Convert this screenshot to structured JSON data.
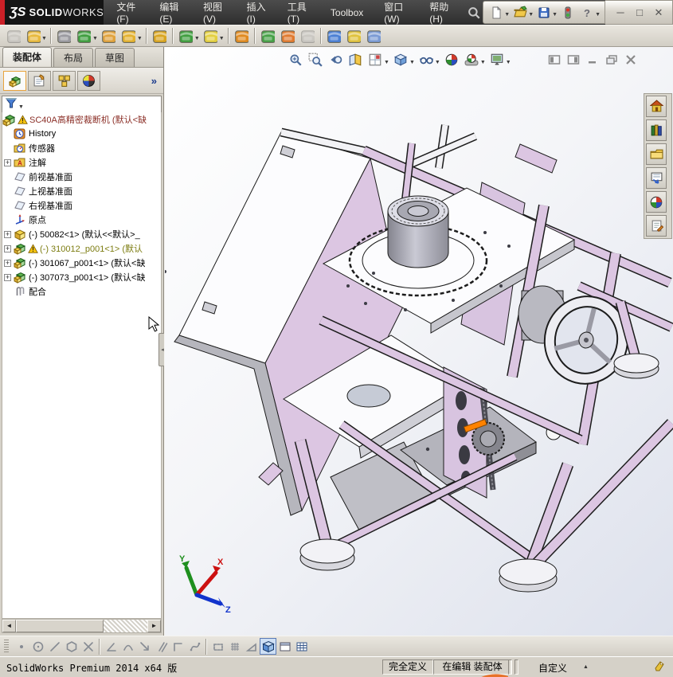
{
  "app": {
    "logo_glyph": "ƷS",
    "logo_brand_bold": "SOLID",
    "logo_brand_light": "WORKS",
    "brand_red": "#cc2027"
  },
  "menubar": {
    "items": [
      "文件(F)",
      "编辑(E)",
      "视图(V)",
      "插入(I)",
      "工具(T)",
      "Toolbox",
      "窗口(W)",
      "帮助(H)"
    ],
    "search_icon": "search-icon"
  },
  "quick_access": {
    "icons": [
      {
        "name": "new-document",
        "dropdown": true
      },
      {
        "name": "open-document",
        "dropdown": true
      },
      {
        "name": "save",
        "dropdown": true
      },
      {
        "name": "options-traffic-light",
        "dropdown": false
      },
      {
        "name": "help",
        "dropdown": true
      }
    ]
  },
  "window_controls": [
    {
      "name": "minimize",
      "glyph": "─"
    },
    {
      "name": "maximize",
      "glyph": "□"
    },
    {
      "name": "close",
      "glyph": "✕"
    }
  ],
  "assembly_toolbar": [
    {
      "name": "insert-components",
      "c": "#b8b5ad",
      "disabled": true
    },
    {
      "name": "open-component",
      "c": "#e8b93c",
      "dropdown": true,
      "sep_after": true
    },
    {
      "name": "attachments",
      "c": "#9a9aa0"
    },
    {
      "name": "mate",
      "c": "#3f9e3f",
      "dropdown": true
    },
    {
      "name": "component-preview-window",
      "c": "#e0a23c"
    },
    {
      "name": "rotate-component",
      "c": "#e3b12f",
      "dropdown": true,
      "sep_after": true
    },
    {
      "name": "smart-fasteners",
      "c": "#d9a520",
      "sep_after": true
    },
    {
      "name": "assembly-features",
      "c": "#3f9e3f",
      "dropdown": true
    },
    {
      "name": "new-part",
      "c": "#e3cf3f",
      "dropdown": true,
      "sep_after": true
    },
    {
      "name": "motion-study-gears",
      "c": "#e08a1f",
      "sep_after": true
    },
    {
      "name": "show-component-window",
      "c": "#46a046"
    },
    {
      "name": "move-component",
      "c": "#e07a2f"
    },
    {
      "name": "suppressed-tool",
      "c": "#b8b5ad",
      "disabled": true,
      "sep_after": true
    },
    {
      "name": "measure",
      "c": "#4a7fd4"
    },
    {
      "name": "interference-detection",
      "c": "#e0c23c"
    },
    {
      "name": "appearance-image",
      "c": "#7a9ad4"
    }
  ],
  "command_tabs": {
    "active": 0,
    "items": [
      "装配体",
      "布局",
      "草图"
    ]
  },
  "feature_manager": {
    "header_icons": [
      "featuremanager-tree",
      "propertymanager",
      "configurationmanager",
      "displaymanager"
    ],
    "expand_chevron": "»",
    "filter_icon": "filter-funnel-icon",
    "tree": [
      {
        "icon": "assembly-top",
        "warning": true,
        "label": "SC40A高精密裁断机  (默认<缺",
        "color": "#8b2f27",
        "level": 0
      },
      {
        "icon": "history-folder",
        "label": "History",
        "level": 1
      },
      {
        "icon": "sensors-folder",
        "label": "传感器",
        "level": 1
      },
      {
        "icon": "annotations-folder",
        "label": "注解",
        "level": 1,
        "expand": true
      },
      {
        "icon": "ref-plane",
        "label": "前视基准面",
        "level": 1
      },
      {
        "icon": "ref-plane",
        "label": "上视基准面",
        "level": 1
      },
      {
        "icon": "ref-plane",
        "label": "右视基准面",
        "level": 1
      },
      {
        "icon": "origin",
        "label": "原点",
        "level": 1
      },
      {
        "icon": "part",
        "label": "(-) 50082<1> (默认<<默认>_",
        "level": 1,
        "expand": true
      },
      {
        "icon": "subassembly",
        "warning": true,
        "label": "(-) 310012_p001<1> (默认",
        "color": "#7c7c10",
        "level": 1,
        "expand": true
      },
      {
        "icon": "subassembly",
        "label": "(-) 301067_p001<1> (默认<缺",
        "level": 1,
        "expand": true
      },
      {
        "icon": "subassembly",
        "label": "(-) 307073_p001<1> (默认<缺",
        "level": 1,
        "expand": true
      },
      {
        "icon": "mates-group",
        "label": "配合",
        "level": 1
      }
    ]
  },
  "heads_up_toolbar": [
    {
      "name": "zoom-to-fit"
    },
    {
      "name": "zoom-to-area"
    },
    {
      "name": "previous-view"
    },
    {
      "name": "section-view"
    },
    {
      "name": "view-orientation",
      "dropdown": true
    },
    {
      "name": "display-style",
      "dropdown": true
    },
    {
      "name": "hide-show-items",
      "dropdown": true
    },
    {
      "name": "edit-appearance"
    },
    {
      "name": "apply-scene",
      "dropdown": true
    },
    {
      "name": "view-settings",
      "dropdown": true
    }
  ],
  "viewport_controls": [
    {
      "name": "collapse-left-pane"
    },
    {
      "name": "collapse-right-pane"
    },
    {
      "name": "minimize-document"
    },
    {
      "name": "restore-document"
    },
    {
      "name": "close-document"
    }
  ],
  "task_pane": [
    {
      "name": "solidworks-resources"
    },
    {
      "name": "design-library"
    },
    {
      "name": "file-explorer"
    },
    {
      "name": "view-palette"
    },
    {
      "name": "appearances-scenes"
    },
    {
      "name": "custom-properties"
    }
  ],
  "sketch_toolbar": [
    {
      "name": "sketch-point",
      "k": "point"
    },
    {
      "name": "circle",
      "k": "circle"
    },
    {
      "name": "line",
      "k": "line"
    },
    {
      "name": "polygon",
      "k": "poly"
    },
    {
      "name": "trim-entities",
      "k": "x",
      "sep_after": true
    },
    {
      "name": "sketch-chamfer",
      "k": "angle"
    },
    {
      "name": "tangent-arc",
      "k": "arc"
    },
    {
      "name": "convert-entities",
      "k": "arrow"
    },
    {
      "name": "offset-entities",
      "k": "parallel"
    },
    {
      "name": "corner-rectangle",
      "k": "corner"
    },
    {
      "name": "spline",
      "k": "spline",
      "sep_after": true
    },
    {
      "name": "linear-sketch-pattern",
      "k": "rectdim"
    },
    {
      "name": "grid-system",
      "k": "grid"
    },
    {
      "name": "triad-tool",
      "k": "tri"
    },
    {
      "name": "shaded-with-edges",
      "k": "cube",
      "active": true
    },
    {
      "name": "section-panel",
      "k": "panel"
    },
    {
      "name": "design-table",
      "k": "table"
    }
  ],
  "status_bar": {
    "product": "SolidWorks Premium 2014 x64 版",
    "define_state": "完全定义",
    "editing_state": "在编辑 装配体",
    "custom_label": "自定义",
    "tag_icon": "note-tag-icon"
  },
  "triad": {
    "axes": [
      {
        "label": "Y",
        "color": "#1e8f1e"
      },
      {
        "label": "X",
        "color": "#cc1111"
      },
      {
        "label": "Z",
        "color": "#1133cc"
      }
    ]
  },
  "colors": {
    "model_lavender": "#dcc6e2",
    "model_highlight_orange": "#ff8200",
    "viewport_top": "#ffffff",
    "viewport_bottom": "#dde1ec",
    "chrome": "#d5d1c8",
    "menubar": "#3c3c3c"
  }
}
